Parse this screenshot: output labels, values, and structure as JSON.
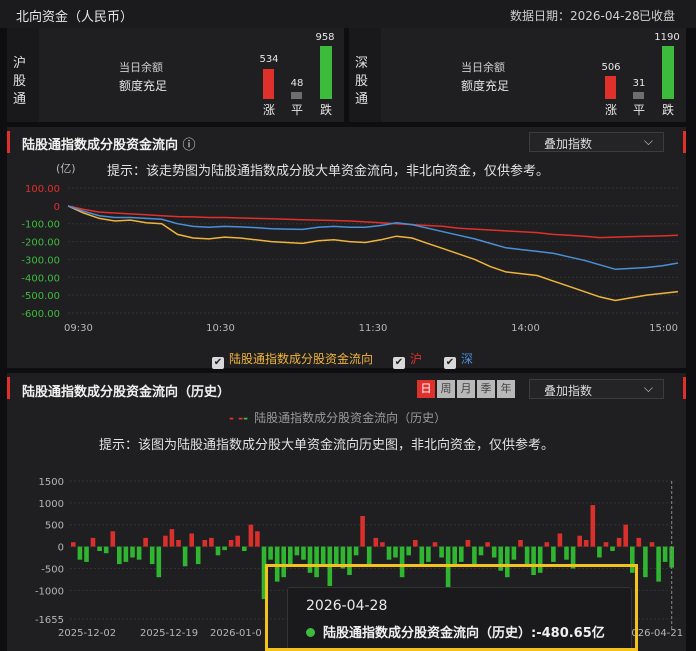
{
  "header": {
    "title": "北向资金（人民币）",
    "date_label": "数据日期：2026-04-28",
    "status": "已收盘"
  },
  "markets": [
    {
      "name_chars": [
        "沪",
        "股",
        "通"
      ],
      "balance_label": "当日余额",
      "balance_value": "额度充足",
      "up": {
        "count": "534",
        "label": "涨"
      },
      "flat": {
        "count": "48",
        "label": "平"
      },
      "down": {
        "count": "958",
        "label": "跌"
      }
    },
    {
      "name_chars": [
        "深",
        "股",
        "通"
      ],
      "balance_label": "当日余额",
      "balance_value": "额度充足",
      "up": {
        "count": "506",
        "label": "涨"
      },
      "flat": {
        "count": "31",
        "label": "平"
      },
      "down": {
        "count": "1190",
        "label": "跌"
      }
    }
  ],
  "intraday": {
    "title": "陆股通指数成分股资金流向",
    "info_icon": "ⓘ",
    "overlay_select": "叠加指数",
    "unit": "(亿)",
    "hint": "提示：该走势图为陆股通指数成分股大单资金流向，非北向资金，仅供参考。",
    "legend": [
      {
        "label": "陆股通指数成分股资金流向",
        "color": "#f0b43c",
        "checked": true
      },
      {
        "label": "沪",
        "color": "#e0302b",
        "checked": true
      },
      {
        "label": "深",
        "color": "#4a90d9",
        "checked": true
      }
    ]
  },
  "history": {
    "title": "陆股通指数成分股资金流向（历史）",
    "tabs": [
      "日",
      "周",
      "月",
      "季",
      "年"
    ],
    "active_tab": "日",
    "overlay_select": "叠加指数",
    "legend_label": "陆股通指数成分股资金流向（历史）",
    "hint": "提示：该图为陆股通指数成分股大单资金流向历史图，非北向资金，仅供参考。",
    "tooltip": {
      "date": "2026-04-28",
      "series_label": "陆股通指数成分股资金流向（历史）:",
      "value": "-480.65亿"
    }
  },
  "chart_data": [
    {
      "type": "line",
      "title": "陆股通指数成分股资金流向",
      "ylabel": "(亿)",
      "y_ticks": [
        "100.00",
        "0",
        "-100.00",
        "-200.00",
        "-300.00",
        "-400.00",
        "-500.00",
        "-600.00"
      ],
      "ylim": [
        -600,
        100
      ],
      "x_ticks": [
        "09:30",
        "10:30",
        "11:30",
        "14:00",
        "15:00"
      ],
      "grid": true,
      "legend_position": "bottom",
      "series": [
        {
          "name": "陆股通指数成分股资金流向",
          "color": "#f0b43c",
          "values": [
            0,
            -40,
            -70,
            -85,
            -80,
            -95,
            -100,
            -160,
            -180,
            -185,
            -175,
            -180,
            -190,
            -200,
            -205,
            -210,
            -195,
            -190,
            -200,
            -205,
            -190,
            -170,
            -180,
            -210,
            -240,
            -270,
            -300,
            -340,
            -370,
            -380,
            -390,
            -420,
            -450,
            -480,
            -510,
            -530,
            -515,
            -500,
            -490,
            -480
          ]
        },
        {
          "name": "沪",
          "color": "#e0302b",
          "values": [
            0,
            -20,
            -35,
            -40,
            -45,
            -50,
            -55,
            -60,
            -62,
            -65,
            -65,
            -68,
            -70,
            -72,
            -75,
            -78,
            -80,
            -82,
            -85,
            -90,
            -95,
            -100,
            -105,
            -110,
            -115,
            -125,
            -130,
            -135,
            -140,
            -145,
            -150,
            -160,
            -165,
            -170,
            -178,
            -175,
            -172,
            -170,
            -168,
            -165
          ]
        },
        {
          "name": "深",
          "color": "#4a90d9",
          "values": [
            0,
            -30,
            -55,
            -65,
            -65,
            -70,
            -75,
            -100,
            -115,
            -120,
            -115,
            -118,
            -122,
            -128,
            -130,
            -132,
            -120,
            -115,
            -120,
            -120,
            -110,
            -95,
            -105,
            -125,
            -145,
            -165,
            -185,
            -210,
            -235,
            -245,
            -255,
            -265,
            -285,
            -305,
            -330,
            -355,
            -350,
            -345,
            -335,
            -320
          ]
        }
      ]
    },
    {
      "type": "bar",
      "title": "陆股通指数成分股资金流向（历史）",
      "y_ticks": [
        "1500",
        "1000",
        "500",
        "0",
        "-500",
        "-1000",
        "-1655"
      ],
      "ylim": [
        -1655,
        1500
      ],
      "x_ticks": [
        "2025-12-02",
        "2025-12-19",
        "2026-01-0",
        "2026-04-21"
      ],
      "grid": true,
      "legend_position": "top",
      "series": [
        {
          "name": "陆股通指数成分股资金流向（历史）",
          "values": [
            100,
            -300,
            -350,
            200,
            -100,
            -150,
            350,
            -400,
            -350,
            -250,
            -300,
            200,
            -400,
            -700,
            250,
            400,
            150,
            -450,
            300,
            -400,
            150,
            200,
            -200,
            -80,
            150,
            250,
            -100,
            500,
            350,
            -1200,
            -300,
            -800,
            -700,
            -400,
            -200,
            -300,
            -600,
            -700,
            -400,
            -900,
            -400,
            -500,
            -650,
            -200,
            700,
            -450,
            200,
            100,
            -300,
            -250,
            -700,
            -200,
            150,
            -400,
            -350,
            100,
            -250,
            -1500,
            -450,
            -350,
            150,
            -400,
            -200,
            100,
            -250,
            -550,
            -700,
            -300,
            150,
            -400,
            -650,
            -600,
            100,
            -350,
            300,
            -300,
            -500,
            250,
            150,
            950,
            -250,
            100,
            -100,
            200,
            500,
            -600,
            200,
            -700,
            100,
            -800,
            -350,
            -480
          ]
        }
      ]
    }
  ]
}
